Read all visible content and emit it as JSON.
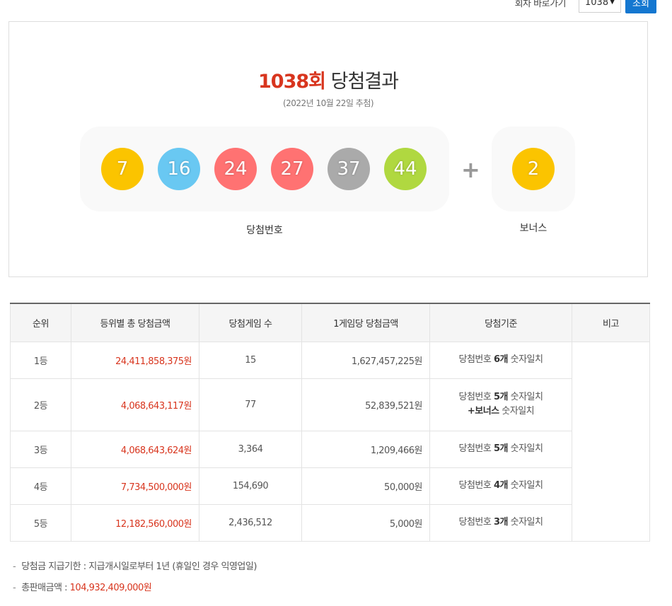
{
  "topbar": {
    "goto_label": "회차 바로가기",
    "round_selected": "1038",
    "search_label": "조회"
  },
  "result": {
    "round": "1038회",
    "title_suffix": "당첨결과",
    "draw_date": "(2022년 10월 22일 추첨)",
    "numbers": [
      {
        "value": "7",
        "color": "#fbc400"
      },
      {
        "value": "16",
        "color": "#69c8f2"
      },
      {
        "value": "24",
        "color": "#ff7272"
      },
      {
        "value": "27",
        "color": "#ff7272"
      },
      {
        "value": "37",
        "color": "#aaaaaa"
      },
      {
        "value": "44",
        "color": "#b0d840"
      }
    ],
    "plus": "+",
    "bonus": {
      "value": "2",
      "color": "#fbc400"
    },
    "numbers_label": "당첨번호",
    "bonus_label": "보너스"
  },
  "table": {
    "headers": [
      "순위",
      "등위별 총 당첨금액",
      "당첨게임 수",
      "1게임당 당첨금액",
      "당첨기준",
      "비고"
    ],
    "rows": [
      {
        "rank": "1등",
        "total": "24,411,858,375원",
        "count": "15",
        "per_game": "1,627,457,225원",
        "crit_pre": "당첨번호 ",
        "crit_bold": "6개",
        "crit_post": " 숫자일치",
        "crit_line2_bold": "",
        "crit_line2_post": ""
      },
      {
        "rank": "2등",
        "total": "4,068,643,117원",
        "count": "77",
        "per_game": "52,839,521원",
        "crit_pre": "당첨번호 ",
        "crit_bold": "5개",
        "crit_post": " 숫자일치",
        "crit_line2_bold": "+보너스",
        "crit_line2_post": " 숫자일치"
      },
      {
        "rank": "3등",
        "total": "4,068,643,624원",
        "count": "3,364",
        "per_game": "1,209,466원",
        "crit_pre": "당첨번호 ",
        "crit_bold": "5개",
        "crit_post": " 숫자일치",
        "crit_line2_bold": "",
        "crit_line2_post": ""
      },
      {
        "rank": "4등",
        "total": "7,734,500,000원",
        "count": "154,690",
        "per_game": "50,000원",
        "crit_pre": "당첨번호 ",
        "crit_bold": "4개",
        "crit_post": " 숫자일치",
        "crit_line2_bold": "",
        "crit_line2_post": ""
      },
      {
        "rank": "5등",
        "total": "12,182,560,000원",
        "count": "2,436,512",
        "per_game": "5,000원",
        "crit_pre": "당첨번호 ",
        "crit_bold": "3개",
        "crit_post": " 숫자일치",
        "crit_line2_bold": "",
        "crit_line2_post": ""
      }
    ]
  },
  "notes": {
    "dash": "-",
    "deadline": "당첨금 지급기한 : 지급개시일로부터 1년 (휴일인 경우 익영업일)",
    "sales_label": "총판매금액 : ",
    "sales_value": "104,932,409,000원"
  }
}
